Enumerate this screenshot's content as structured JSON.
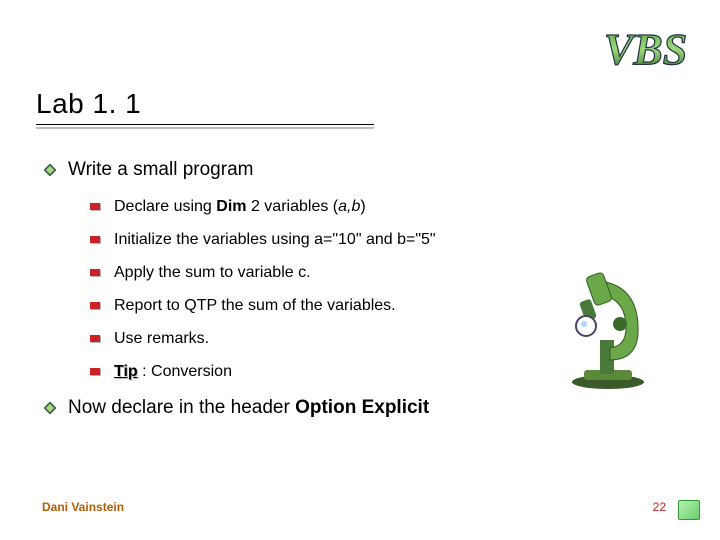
{
  "logo_text": "VBS",
  "title": "Lab 1. 1",
  "main": {
    "item1_text": "Write a small program",
    "sub": [
      {
        "pre": "Declare using ",
        "bold": "Dim",
        "post": " 2 variables (",
        "ital": "a,b",
        "post2": ")"
      },
      {
        "text": "Initialize the variables using a=\"10\" and b=\"5\""
      },
      {
        "text": "Apply the sum to variable c."
      },
      {
        "text": "Report to QTP the sum of the variables."
      },
      {
        "text": "Use remarks."
      },
      {
        "tip": "Tip",
        "after": " : Conversion"
      }
    ],
    "item2_pre": "Now declare in the header ",
    "item2_bold": "Option Explicit"
  },
  "footer": {
    "author": "Dani Vainstein",
    "page": "22"
  },
  "icons": {
    "logo": "vbs-logo",
    "diamond_bullet": "diamond-bullet-icon",
    "square_bullet": "square-bullet-icon",
    "microscope": "microscope-icon",
    "corner": "slide-corner-icon"
  }
}
